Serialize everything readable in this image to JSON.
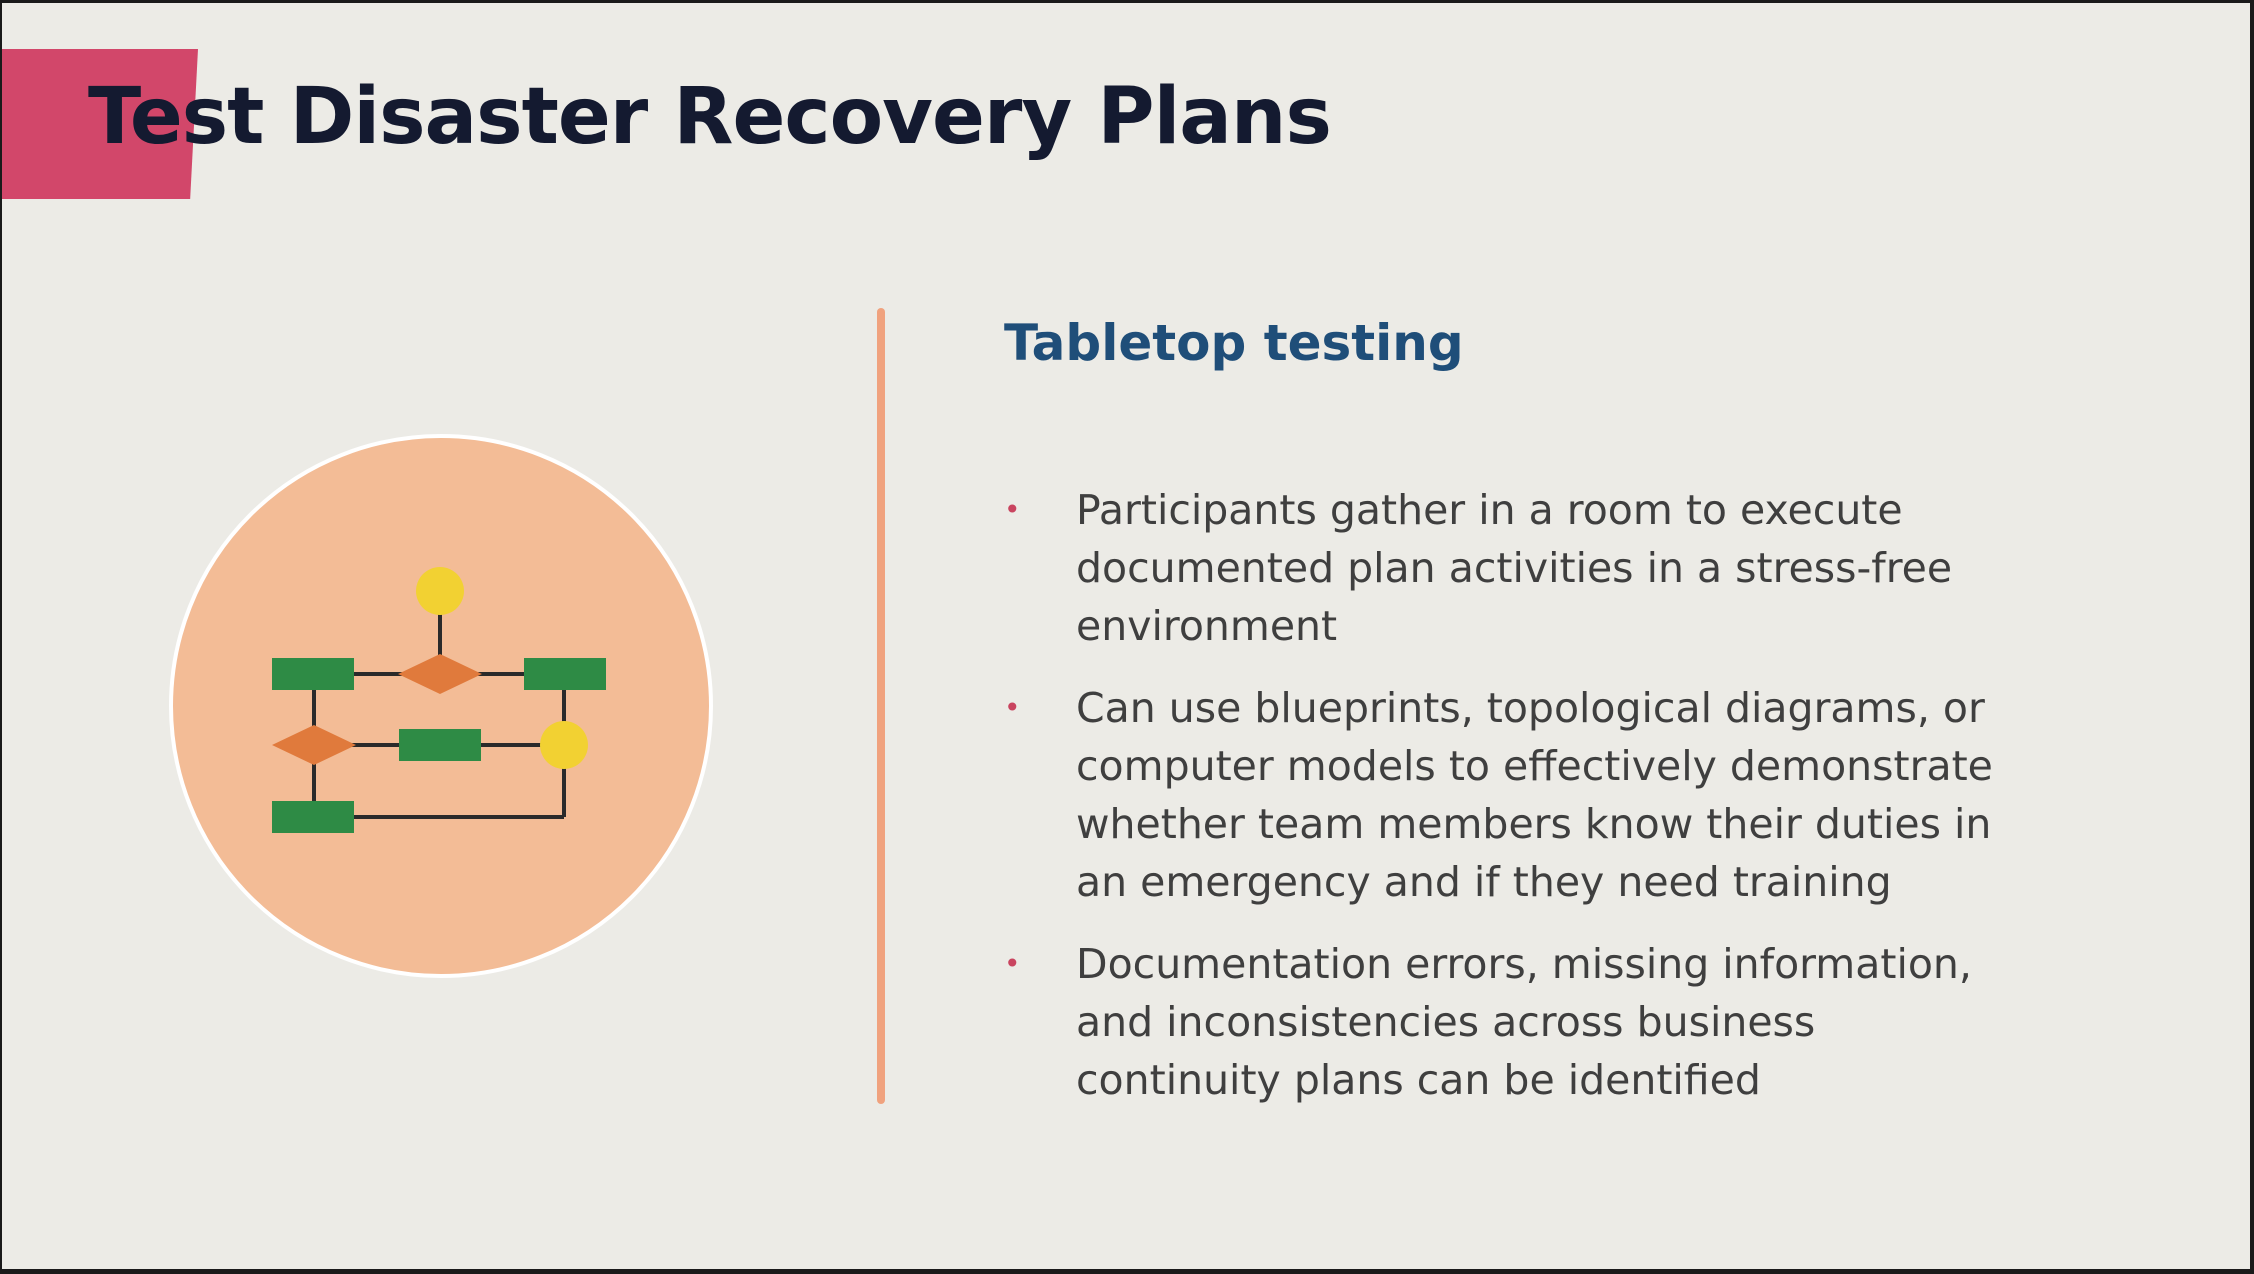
{
  "slide": {
    "title": "Test Disaster Recovery Plans",
    "section_heading": "Tabletop testing",
    "bullets": [
      "Participants gather in a room to execute documented plan activities in a stress-free environment",
      "Can use blueprints, topological diagrams, or computer models to effectively demonstrate whether team members know their duties in an emergency and if they need training",
      "Documentation errors, missing information, and inconsistencies across business continuity plans can be identified"
    ],
    "bullet_marker": "•",
    "illustration_icon": "flowchart-icon"
  },
  "colors": {
    "background": "#ecebe6",
    "title_accent": "#d2476a",
    "title_text": "#141a30",
    "heading_text": "#1f4e79",
    "body_text": "#3f3f3f",
    "bullet_marker": "#c9445f",
    "divider": "#f0a27e",
    "circle_fill": "#f3bc96",
    "flow_green": "#2e8b45",
    "flow_orange": "#e07a3c",
    "flow_yellow": "#f2d132"
  }
}
